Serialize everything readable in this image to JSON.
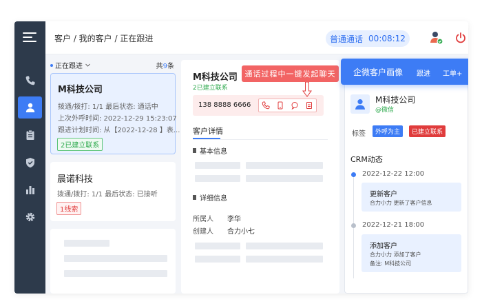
{
  "header": {
    "breadcrumb": "客户 / 我的客户 / 正在跟进",
    "call_label": "普通通话",
    "call_timer": "00:08:12"
  },
  "list": {
    "filter_label": "正在跟进",
    "total_prefix": "共",
    "total_count": "9",
    "total_suffix": "条",
    "cards": [
      {
        "name": "M科技公司",
        "line1": "拨通/拨打:  1/1    最后状态: 通话中",
        "line2": "上次外呼时间:  2022-12-29 15:23:07",
        "line3": "跟进计划时间: 从【2022-12-28 】表...",
        "tag": "2已建立联系"
      },
      {
        "name": "晨诺科技",
        "line1": "拨通/拨打:  1/1    最后状态: 已接听",
        "tag": "1线索"
      }
    ]
  },
  "detail": {
    "company": "M科技公司",
    "sub": "2已建立联系",
    "phone": "138 8888 6666",
    "tab": "客户详情",
    "section_basic": "基本信息",
    "section_detail": "详细信息",
    "owner_key": "所属人",
    "owner_val": "李华",
    "creator_key": "创建人",
    "creator_val": "合力小七"
  },
  "tooltip": "通话过程中一键发起聊天",
  "portrait": {
    "title": "企微客户画像",
    "action_follow": "跟进",
    "action_ticket": "工单+",
    "name": "M科技公司",
    "sub": "@微信",
    "label_key": "标签",
    "tags": [
      "外呼为主",
      "已建立联系"
    ],
    "crm_title": "CRM动态",
    "timeline": [
      {
        "time": "2022-12-22 12:00",
        "title": "更新客户",
        "lines": [
          "合力小力 更新了客户信息"
        ]
      },
      {
        "time": "2022-12-21 18:00",
        "title": "添加客户",
        "lines": [
          "合力小力 添加了客户",
          "备注: M科技公司"
        ]
      }
    ]
  },
  "colors": {
    "accent": "#3d7cf5",
    "sidebar": "#2d3a4b",
    "success": "#2aa84a",
    "danger": "#e03c3c"
  },
  "icons": [
    "menu-icon",
    "phone-icon",
    "user-icon",
    "clipboard-icon",
    "shield-icon",
    "bar-chart-icon",
    "gear-icon",
    "power-icon",
    "message-icon",
    "document-icon"
  ]
}
